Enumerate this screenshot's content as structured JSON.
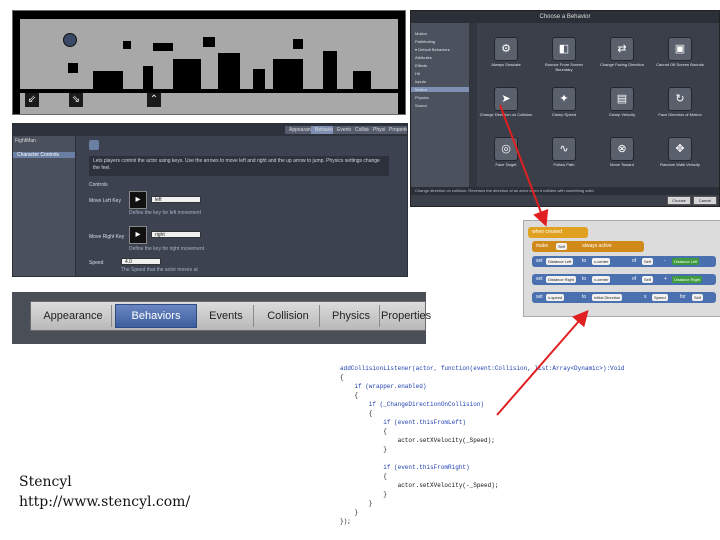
{
  "game": {
    "controls": [
      "⇙",
      "⇘",
      "⌃"
    ]
  },
  "actor_editor": {
    "top_tabs": [
      "Appearance",
      "Behaviors",
      "Events",
      "Collision",
      "Physics",
      "Properties"
    ],
    "left_title": "FightMan",
    "left_selected": "Character Controls",
    "description": "Lets players control the actor using keys. Use the arrows to move left and right and the up arrow to jump. Physics settings change the feel.",
    "section_label": "Controls",
    "field1_label": "Move Left Key",
    "field1_value": "left",
    "field1_hint": "Define the key for left movement",
    "field2_label": "Move Right Key",
    "field2_value": "right",
    "field2_hint": "Define the key for right movement",
    "field3_label": "Speed",
    "field3_value": "4.0",
    "field3_hint": "The Speed that the actor moves at"
  },
  "palette": {
    "title": "Choose a Behavior",
    "tree": [
      {
        "label": "Motion",
        "selected": false
      },
      {
        "label": "Pathfinding",
        "selected": false
      },
      {
        "label": "▾ Default Behaviors",
        "selected": false
      },
      {
        "label": "Attributes",
        "selected": false
      },
      {
        "label": "Effects",
        "selected": false
      },
      {
        "label": "Hit",
        "selected": false
      },
      {
        "label": "Inputs",
        "selected": false
      },
      {
        "label": "Motion",
        "selected": true
      },
      {
        "label": "Physics",
        "selected": false
      },
      {
        "label": "Sound",
        "selected": false
      }
    ],
    "behaviors": [
      {
        "label": "Always Simulate",
        "icon": "⚙"
      },
      {
        "label": "Bounce From Screen Boundary",
        "icon": "◧"
      },
      {
        "label": "Change Facing Direction",
        "icon": "⇄"
      },
      {
        "label": "Cannot Off Screen Bounds",
        "icon": "▣"
      },
      {
        "label": "Change Direction on Collision",
        "icon": "➤"
      },
      {
        "label": "Clamp Speed",
        "icon": "✦"
      },
      {
        "label": "Clamp Velocity",
        "icon": "▤"
      },
      {
        "label": "Face Direction of Motion",
        "icon": "↻"
      },
      {
        "label": "Face Target",
        "icon": "◎"
      },
      {
        "label": "Follow Path",
        "icon": "∿"
      },
      {
        "label": "Move Toward",
        "icon": "⊗"
      },
      {
        "label": "Random Walk Velocity",
        "icon": "✥"
      }
    ],
    "description_text": "Change direction on collision: Reverses the direction of an actor when it collides with something solid",
    "buttons": [
      "Choose",
      "Cancel"
    ]
  },
  "tabs": {
    "items": [
      "Appearance",
      "Behaviors",
      "Events",
      "Collision",
      "Physics",
      "Properties"
    ],
    "active": "Behaviors"
  },
  "blocks": {
    "header": "when created",
    "line1": [
      "make",
      "Self",
      "always active"
    ],
    "line2": [
      "set",
      "Distance Left",
      "to",
      "x-center",
      "of",
      "Self",
      "-",
      "Distance Left"
    ],
    "line3": [
      "set",
      "Distance Right",
      "to",
      "x-center",
      "of",
      "Self",
      "+",
      "Distance Right"
    ],
    "line4": [
      "set",
      "x-speed",
      "to",
      "Initial Direction",
      "x",
      "Speed",
      "for",
      "Self"
    ]
  },
  "code": {
    "lines": [
      "addCollisionListener(actor, function(event:Collision, list:Array<Dynamic>):Void",
      "{",
      "    if (wrapper.enabled)",
      "    {",
      "        if (_ChangeDirectionOnCollision)",
      "        {",
      "            if (event.thisFromLeft)",
      "            {",
      "                actor.setXVelocity(_Speed);",
      "            }",
      "",
      "            if (event.thisFromRight)",
      "            {",
      "                actor.setXVelocity(-_Speed);",
      "            }",
      "        }",
      "    }",
      "});"
    ]
  },
  "caption": {
    "line1": "Stencyl",
    "line2": "http://www.stencyl.com/"
  },
  "colors": {
    "accent": "#4a70b0",
    "arrow": "#e02020",
    "tab_active": "#3d5f9f"
  }
}
